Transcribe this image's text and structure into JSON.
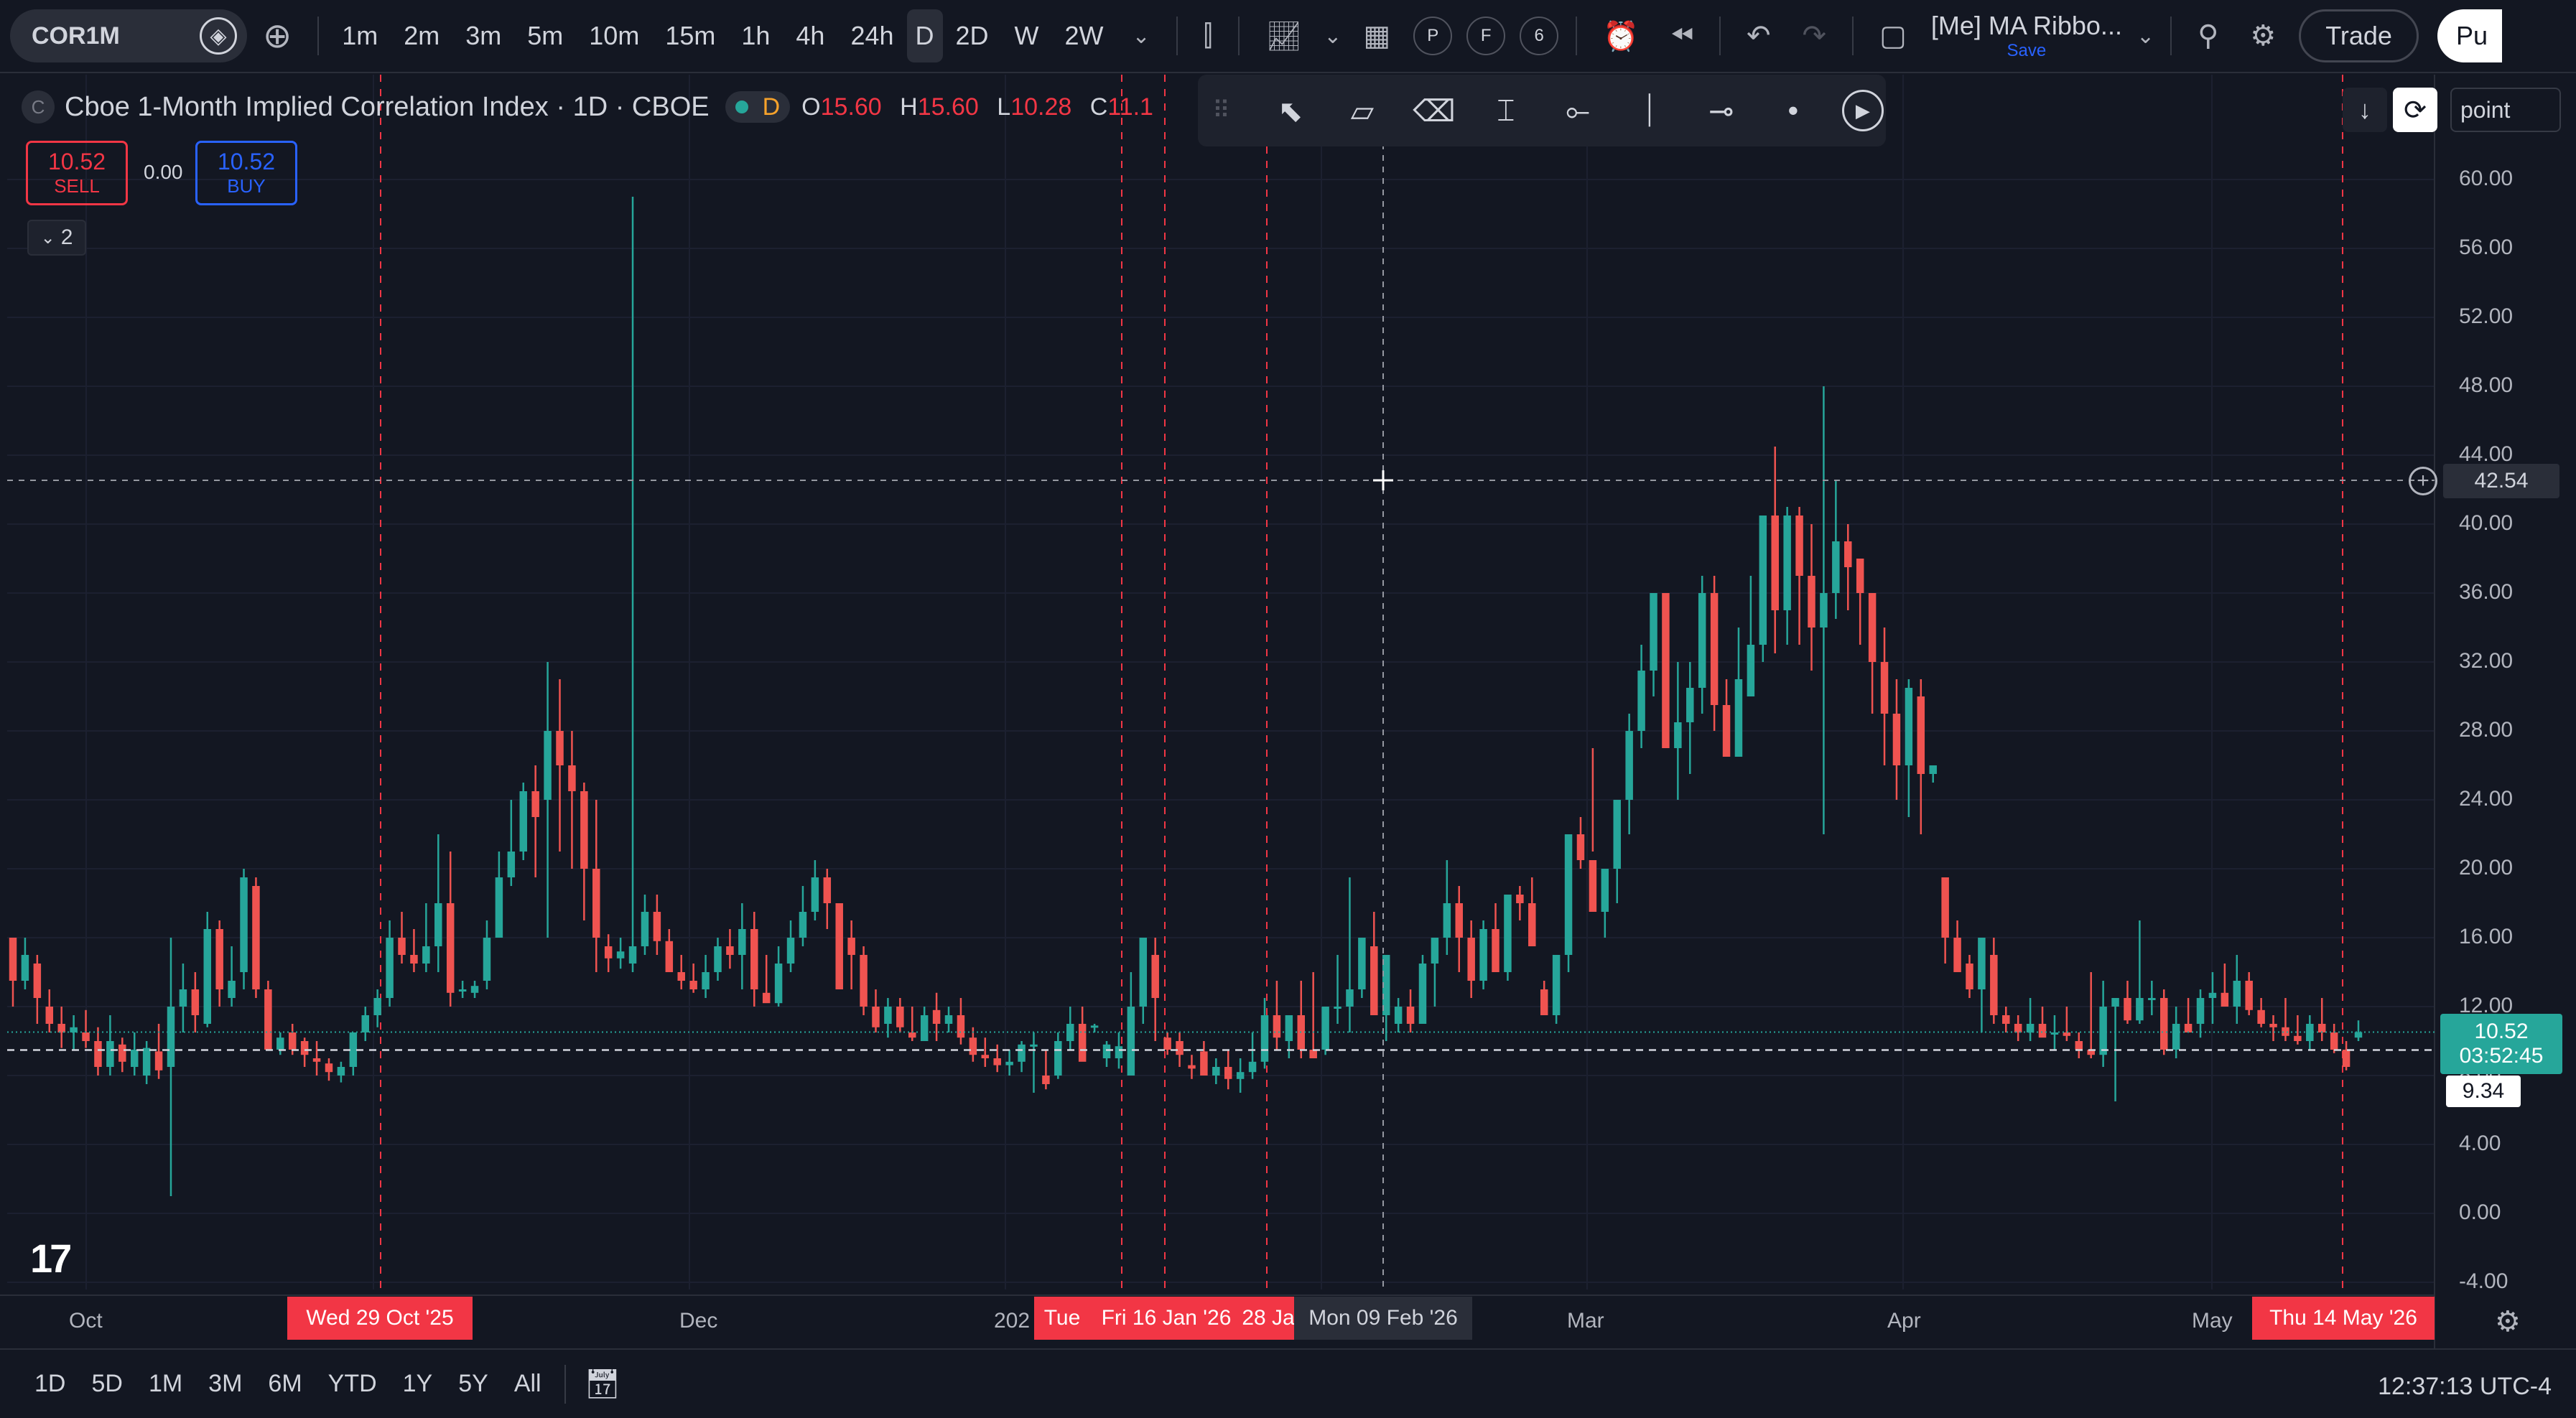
{
  "topbar": {
    "symbol": "COR1M",
    "intervals": [
      "1m",
      "2m",
      "3m",
      "5m",
      "10m",
      "15m",
      "1h",
      "4h",
      "24h",
      "D",
      "2D",
      "W",
      "2W"
    ],
    "active_interval": "D",
    "indicator_circles": [
      "P",
      "F",
      "6"
    ],
    "layout_name": "[Me] MA Ribbo...",
    "layout_save": "Save",
    "trade_label": "Trade",
    "publish_label": "Pu"
  },
  "legend": {
    "symbol_icon": "C",
    "title": "Cboe 1-Month Implied Correlation Index · 1D · CBOE",
    "status_letter": "D",
    "open_key": "O",
    "open": "15.60",
    "high_key": "H",
    "high": "15.60",
    "low_key": "L",
    "low": "10.28",
    "close_key": "C",
    "close": "11.1"
  },
  "orders": {
    "sell_price": "10.52",
    "sell_label": "SELL",
    "spread": "0.00",
    "buy_price": "10.52",
    "buy_label": "BUY",
    "collapse_count": "2"
  },
  "right_controls": {
    "point_label": "point"
  },
  "price_axis": {
    "ticks": [
      "60.00",
      "56.00",
      "52.00",
      "48.00",
      "44.00",
      "40.00",
      "36.00",
      "32.00",
      "28.00",
      "24.00",
      "20.00",
      "16.00",
      "12.00",
      "8.00",
      "4.00",
      "0.00",
      "-4.00"
    ],
    "crosshair_price": "42.54",
    "last_price": "10.52",
    "countdown": "03:52:45",
    "low_marker": "9.34"
  },
  "time_axis": {
    "ticks": [
      "Oct",
      "Dec",
      "202",
      "Mar",
      "Apr",
      "May"
    ],
    "marker_labels": [
      "Wed 29 Oct '25",
      "Tue",
      "Fri 16 Jan '26",
      "28 Ja",
      "Mon 09 Feb '26",
      "Thu 14 May '26"
    ]
  },
  "bottombar": {
    "ranges": [
      "1D",
      "5D",
      "1M",
      "3M",
      "6M",
      "YTD",
      "1Y",
      "5Y",
      "All"
    ],
    "clock": "12:37:13 UTC-4"
  },
  "colors": {
    "up": "#26a69a",
    "down": "#ef5350",
    "background": "#131722",
    "marker": "#f23645"
  },
  "chart_data": {
    "type": "candlestick",
    "title": "Cboe 1-Month Implied Correlation Index",
    "interval": "1D",
    "ylim": [
      -4,
      62
    ],
    "ticks": [
      60,
      56,
      52,
      48,
      44,
      40,
      36,
      32,
      28,
      24,
      20,
      16,
      12,
      8,
      4,
      0,
      -4
    ],
    "crosshair_price": 42.54,
    "last_price": 10.52,
    "grid": true,
    "candles": [
      [
        16,
        16,
        12,
        13.5
      ],
      [
        13.5,
        16,
        13,
        15
      ],
      [
        14.5,
        15,
        11,
        12.5
      ],
      [
        12,
        13,
        10.5,
        11
      ],
      [
        11,
        12,
        9.6,
        10.5
      ],
      [
        10.5,
        11.5,
        9.5,
        10.8
      ],
      [
        10.5,
        11.8,
        9.6,
        10
      ],
      [
        10,
        10.8,
        8,
        8.5
      ],
      [
        8.5,
        11.5,
        8,
        10
      ],
      [
        9.8,
        10.2,
        8.2,
        8.8
      ],
      [
        8.5,
        10.5,
        8,
        9.5
      ],
      [
        8,
        10,
        7.5,
        9.6
      ],
      [
        9.4,
        11,
        7.8,
        8.3
      ],
      [
        8.5,
        16,
        1,
        12
      ],
      [
        12,
        14.5,
        10.5,
        13
      ],
      [
        13,
        14,
        10.5,
        11.5
      ],
      [
        11,
        17.5,
        10.8,
        16.5
      ],
      [
        16.5,
        17,
        12,
        13
      ],
      [
        12.5,
        15.5,
        12,
        13.5
      ],
      [
        14,
        20,
        13,
        19.5
      ],
      [
        19,
        19.5,
        12.5,
        13
      ],
      [
        13,
        13.5,
        10,
        9.5
      ],
      [
        9.5,
        10.5,
        9.2,
        10.2
      ],
      [
        10.5,
        11,
        9.2,
        9.5
      ],
      [
        10,
        10.2,
        8.5,
        9.2
      ],
      [
        9,
        10,
        8,
        8.8
      ],
      [
        8.7,
        9,
        7.7,
        8.2
      ],
      [
        8,
        8.8,
        7.6,
        8.5
      ],
      [
        8.5,
        10.5,
        8,
        10.5
      ],
      [
        10.5,
        12,
        10,
        11.5
      ],
      [
        11.5,
        13,
        10.8,
        12.5
      ],
      [
        12.5,
        17,
        12,
        16
      ],
      [
        16,
        17.5,
        14.5,
        15
      ],
      [
        15,
        16.5,
        14,
        14.5
      ],
      [
        14.5,
        18,
        14,
        15.5
      ],
      [
        15.5,
        22,
        14,
        18
      ],
      [
        18,
        21,
        12,
        12.8
      ],
      [
        13,
        13.5,
        12.5,
        13
      ],
      [
        12.8,
        13.5,
        12.5,
        13.2
      ],
      [
        13.5,
        17,
        13,
        16
      ],
      [
        16,
        21,
        16,
        19.5
      ],
      [
        19.5,
        24,
        19,
        21
      ],
      [
        21,
        25,
        20.5,
        24.5
      ],
      [
        24.5,
        26,
        19.5,
        23
      ],
      [
        24,
        32,
        16,
        28
      ],
      [
        28,
        31,
        21,
        26
      ],
      [
        26,
        28,
        20,
        24.5
      ],
      [
        24.5,
        25,
        17,
        20
      ],
      [
        20,
        24,
        14,
        16
      ],
      [
        15.5,
        16.2,
        14,
        14.8
      ],
      [
        14.8,
        16,
        14.2,
        15.2
      ],
      [
        14.5,
        59,
        14,
        15.5
      ],
      [
        15.5,
        18.5,
        15,
        17.5
      ],
      [
        17.5,
        18.5,
        15,
        15.8
      ],
      [
        15.8,
        16.5,
        14,
        14
      ],
      [
        14,
        15,
        13,
        13.5
      ],
      [
        13.5,
        14.5,
        12.8,
        13
      ],
      [
        13,
        15,
        12.5,
        14
      ],
      [
        14,
        16,
        13.5,
        15.5
      ],
      [
        15.5,
        16.5,
        14.2,
        15
      ],
      [
        15,
        18,
        13,
        16.5
      ],
      [
        16.5,
        17.5,
        12,
        13
      ],
      [
        12.8,
        15,
        12.5,
        12.2
      ],
      [
        12.2,
        15.5,
        12,
        14.5
      ],
      [
        14.5,
        17,
        14,
        16
      ],
      [
        16,
        19,
        15.5,
        17.5
      ],
      [
        17.5,
        20.5,
        17,
        19.5
      ],
      [
        19.5,
        20,
        16.5,
        18
      ],
      [
        18,
        17.5,
        13,
        13
      ],
      [
        16,
        17,
        13,
        15
      ],
      [
        15,
        15.5,
        11.5,
        12
      ],
      [
        12,
        13,
        10.5,
        10.8
      ],
      [
        11,
        12.5,
        10.2,
        12
      ],
      [
        12,
        12.5,
        10.5,
        10.8
      ],
      [
        10.5,
        12,
        10,
        10.2
      ],
      [
        10,
        12,
        10,
        11.5
      ],
      [
        11.8,
        12.8,
        10,
        11
      ],
      [
        11,
        12,
        10.5,
        11.5
      ],
      [
        11.5,
        12.5,
        9.8,
        10.2
      ],
      [
        10.2,
        10.8,
        8.8,
        9.2
      ],
      [
        9.2,
        10.2,
        8.5,
        9
      ],
      [
        9,
        9.8,
        8.2,
        8.6
      ],
      [
        8.6,
        9.5,
        8,
        8.8
      ],
      [
        8.8,
        10,
        8.2,
        9.8
      ],
      [
        9.8,
        10.5,
        7,
        9.8
      ],
      [
        8,
        9.5,
        7.2,
        7.5
      ],
      [
        8,
        10.5,
        7.8,
        10
      ],
      [
        10,
        12,
        9.5,
        11
      ],
      [
        11,
        12,
        9.5,
        8.8
      ],
      [
        10.8,
        11,
        10.5,
        10.9
      ],
      [
        9,
        10,
        8.5,
        9.8
      ],
      [
        9,
        10.5,
        8.4,
        9.7
      ],
      [
        8,
        14,
        8,
        12
      ],
      [
        12,
        15,
        11,
        16
      ],
      [
        15,
        16,
        10,
        12.5
      ],
      [
        10.2,
        10.5,
        9.2,
        9.5
      ],
      [
        10,
        10.5,
        8.5,
        9.2
      ],
      [
        8.6,
        9.2,
        7.8,
        8.4
      ],
      [
        9.4,
        10,
        8.5,
        8
      ],
      [
        8,
        9,
        7.5,
        8.5
      ],
      [
        8.5,
        9.5,
        7.2,
        7.8
      ],
      [
        7.8,
        9,
        7,
        8.2
      ],
      [
        8.2,
        10.5,
        7.8,
        8.8
      ],
      [
        8.8,
        12.5,
        8.4,
        11.5
      ],
      [
        11.5,
        13.5,
        9.5,
        10.2
      ],
      [
        10,
        11,
        9,
        11.5
      ],
      [
        11.5,
        13.5,
        9,
        9.5
      ],
      [
        9.5,
        14,
        9,
        9
      ],
      [
        9.5,
        12,
        9.2,
        12
      ],
      [
        12,
        15,
        11,
        12
      ],
      [
        12,
        19.5,
        10.5,
        13
      ],
      [
        13,
        15.5,
        12.5,
        16
      ],
      [
        15.5,
        17.5,
        14.5,
        11.5
      ],
      [
        11.5,
        15,
        10,
        15
      ],
      [
        11,
        12.5,
        10.5,
        12
      ],
      [
        12,
        13,
        10.5,
        11
      ],
      [
        11,
        15,
        11,
        14.5
      ],
      [
        14.5,
        16,
        12,
        16
      ],
      [
        16,
        20.5,
        15,
        18
      ],
      [
        18,
        19,
        14,
        16
      ],
      [
        16,
        17,
        12.5,
        13.5
      ],
      [
        13.5,
        17,
        13,
        16.5
      ],
      [
        16.5,
        18,
        14,
        14
      ],
      [
        14,
        18.5,
        13.5,
        18.5
      ],
      [
        18.5,
        19,
        17,
        18
      ],
      [
        18,
        19.5,
        17,
        15.5
      ],
      [
        13,
        13.5,
        11.5,
        11.5
      ],
      [
        11.5,
        15,
        11,
        15
      ],
      [
        15,
        21,
        14,
        22
      ],
      [
        22,
        23,
        20,
        20.5
      ],
      [
        20.5,
        27,
        21,
        17.5
      ],
      [
        17.5,
        19.5,
        16,
        20
      ],
      [
        20,
        23,
        18,
        24
      ],
      [
        24,
        29,
        22,
        28
      ],
      [
        28,
        33,
        27,
        31.5
      ],
      [
        31.5,
        36,
        30,
        36
      ],
      [
        36,
        36,
        27,
        27
      ],
      [
        27,
        32,
        24,
        28.5
      ],
      [
        28.5,
        32,
        25.5,
        30.5
      ],
      [
        30.5,
        37,
        29,
        36
      ],
      [
        36,
        37,
        28,
        29.5
      ],
      [
        29.5,
        31,
        27,
        26.5
      ],
      [
        26.5,
        34,
        30,
        31
      ],
      [
        30,
        37,
        30,
        33
      ],
      [
        33,
        40,
        32,
        40.5
      ],
      [
        40.5,
        44.5,
        32.5,
        35
      ],
      [
        35,
        41,
        33,
        40.5
      ],
      [
        40.5,
        41,
        33,
        37
      ],
      [
        37,
        40,
        31.5,
        34
      ],
      [
        34,
        48,
        22,
        36
      ],
      [
        36,
        42.5,
        34.5,
        39
      ],
      [
        39,
        40,
        35,
        37.5
      ],
      [
        38,
        38,
        33,
        36
      ],
      [
        36,
        35.5,
        29,
        32
      ],
      [
        32,
        34,
        26,
        29
      ],
      [
        29,
        31,
        24,
        26
      ],
      [
        26,
        31,
        23,
        30.5
      ],
      [
        30,
        31,
        22,
        25.5
      ],
      [
        25.5,
        26,
        25,
        26
      ],
      [
        19.5,
        19.5,
        14.5,
        16
      ],
      [
        16,
        17,
        14.5,
        14
      ],
      [
        14.5,
        15,
        12.5,
        13
      ],
      [
        13,
        13.5,
        10.5,
        16
      ],
      [
        15,
        16,
        11,
        11.5
      ],
      [
        11.5,
        12,
        10.5,
        11
      ],
      [
        11,
        11.5,
        10,
        10.5
      ],
      [
        10.5,
        12.5,
        10,
        11
      ],
      [
        11,
        12,
        10.5,
        10.2
      ],
      [
        10.5,
        11.5,
        9.5,
        10.5
      ],
      [
        10.5,
        12,
        10,
        10.3
      ],
      [
        10,
        10.5,
        9,
        9.5
      ],
      [
        9.5,
        14,
        9,
        9.2
      ],
      [
        9.2,
        13.5,
        8.5,
        12
      ],
      [
        12,
        12.5,
        6.5,
        12.5
      ],
      [
        12.5,
        13.5,
        11,
        11.2
      ],
      [
        11.2,
        17,
        11,
        12.5
      ],
      [
        12.5,
        13.5,
        11.5,
        12.5
      ],
      [
        12.5,
        13,
        9.2,
        9.5
      ],
      [
        9.5,
        12,
        9,
        11
      ],
      [
        11,
        12.5,
        10.5,
        10.5
      ],
      [
        11,
        13,
        10.2,
        12.5
      ],
      [
        12.5,
        14,
        11,
        12.8
      ],
      [
        12.8,
        14.5,
        12,
        12
      ],
      [
        12,
        15,
        11,
        13.5
      ],
      [
        13.5,
        14,
        11.5,
        11.8
      ],
      [
        11.8,
        12.5,
        10.8,
        11
      ],
      [
        11,
        11.5,
        10,
        10.8
      ],
      [
        10.8,
        12.5,
        10,
        10.3
      ],
      [
        10.3,
        11.5,
        9.8,
        10
      ],
      [
        10,
        11.5,
        9.5,
        11
      ],
      [
        11,
        12.5,
        10,
        10.5
      ],
      [
        10.5,
        11,
        9.3,
        9.5
      ],
      [
        9.5,
        10,
        8.3,
        8.5
      ],
      [
        10.2,
        11.2,
        10,
        10.52
      ]
    ]
  }
}
